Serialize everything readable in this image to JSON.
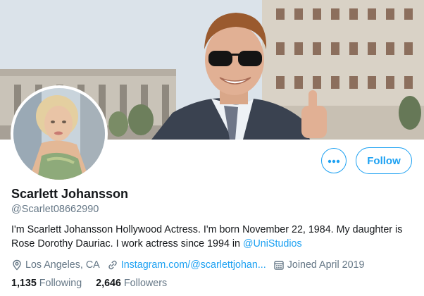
{
  "profile": {
    "name": "Scarlett Johansson",
    "handle": "@Scarlet08662990",
    "bio_text": "I'm Scarlett Johansson  Hollywood Actress. I'm born November 22, 1984. My daughter is Rose Dorothy Dauriac. I work actress since 1994 in ",
    "bio_mention": "@UniStudios",
    "location": "Los Angeles, CA",
    "website": "Instagram.com/@scarlettjohan...",
    "joined": "Joined April 2019",
    "following_count": "1,135",
    "following_label": "Following",
    "followers_count": "2,646",
    "followers_label": "Followers"
  },
  "actions": {
    "more_label": "More",
    "follow_label": "Follow"
  },
  "icons": {
    "more": "more-dots-icon",
    "location": "location-pin-icon",
    "link": "link-icon",
    "calendar": "calendar-icon"
  },
  "colors": {
    "accent": "#1da1f2",
    "secondary_text": "#657786",
    "primary_text": "#14171a"
  }
}
